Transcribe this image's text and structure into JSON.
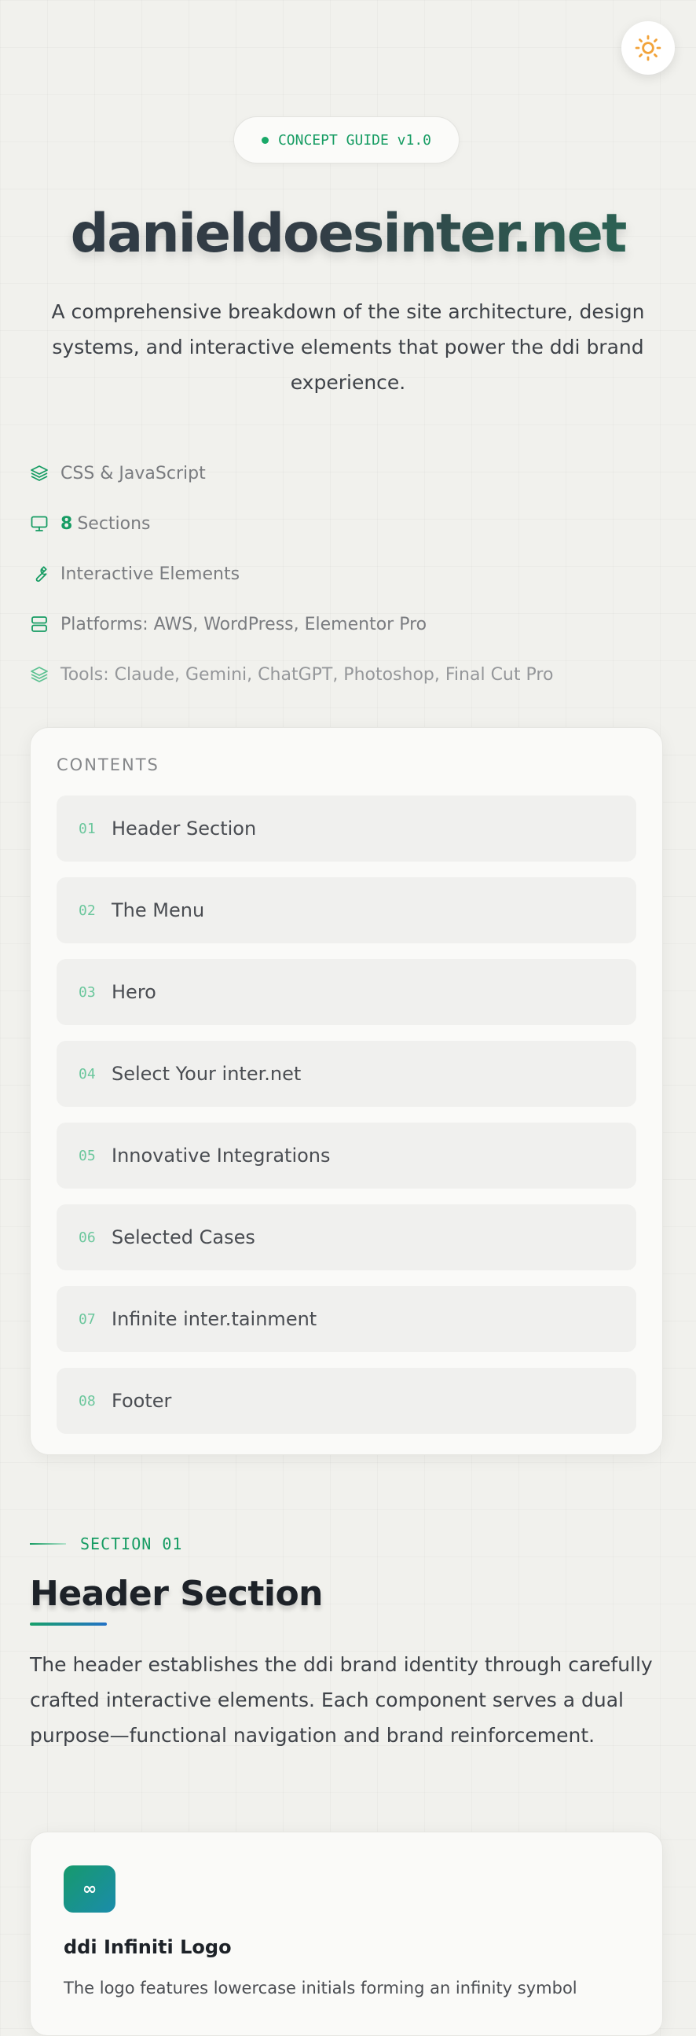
{
  "header": {
    "theme_toggle_icon": "sun-icon",
    "badge_label": "CONCEPT GUIDE v1.0",
    "site_title": "danieldoesinter.net",
    "intro": "A comprehensive breakdown of the site architecture, design systems, and interactive elements that power the ddi brand experience."
  },
  "meta": {
    "tech": "CSS & JavaScript",
    "sections_count": "8",
    "sections_label": "Sections",
    "interactive": "Interactive Elements",
    "platforms": "Platforms: AWS, WordPress, Elementor Pro",
    "tools": "Tools: Claude, Gemini, ChatGPT, Photoshop, Final Cut Pro"
  },
  "toc": {
    "title": "CONTENTS",
    "items": [
      {
        "num": "01",
        "label": "Header Section"
      },
      {
        "num": "02",
        "label": "The Menu"
      },
      {
        "num": "03",
        "label": "Hero"
      },
      {
        "num": "04",
        "label": "Select Your inter.net"
      },
      {
        "num": "05",
        "label": "Innovative Integrations"
      },
      {
        "num": "06",
        "label": "Selected Cases"
      },
      {
        "num": "07",
        "label": "Infinite inter.tainment"
      },
      {
        "num": "08",
        "label": "Footer"
      }
    ]
  },
  "section1": {
    "tag": "SECTION 01",
    "heading": "Header Section",
    "description": "The header establishes the ddi brand identity through carefully crafted interactive elements. Each component serves a dual purpose—functional navigation and brand reinforcement."
  },
  "logo_card": {
    "icon_symbol": "∞",
    "title": "ddi Infiniti Logo",
    "description": "The logo features lowercase initials forming an infinity symbol"
  },
  "colors": {
    "accent_green": "#169c63",
    "sun": "#f2a33a",
    "background": "#f1f1ed"
  }
}
